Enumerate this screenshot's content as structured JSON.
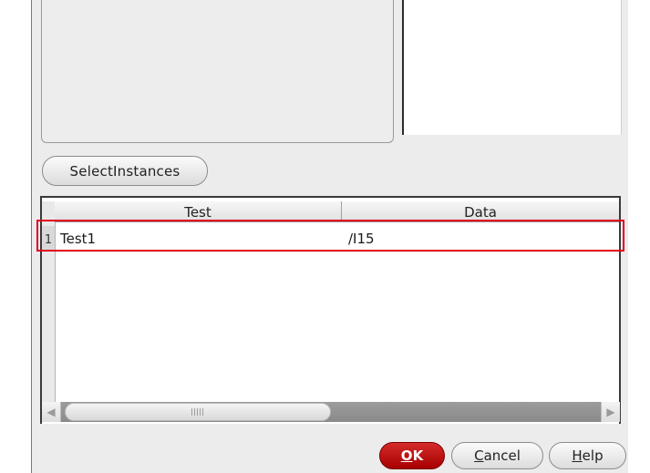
{
  "buttons": {
    "select_instances": "SelectInstances",
    "ok": {
      "mnemonic": "O",
      "rest": "K"
    },
    "cancel": {
      "mnemonic": "C",
      "rest": "ancel"
    },
    "help": {
      "mnemonic": "H",
      "rest": "elp"
    }
  },
  "table": {
    "columns": [
      "Test",
      "Data"
    ],
    "rows": [
      {
        "index": "1",
        "test": "Test1",
        "data": "/I15"
      }
    ]
  },
  "colors": {
    "highlight": "#e3001b",
    "ok_button": "#c00000"
  },
  "icons": {
    "scroll_left": "triangle-left",
    "scroll_right": "triangle-right"
  }
}
